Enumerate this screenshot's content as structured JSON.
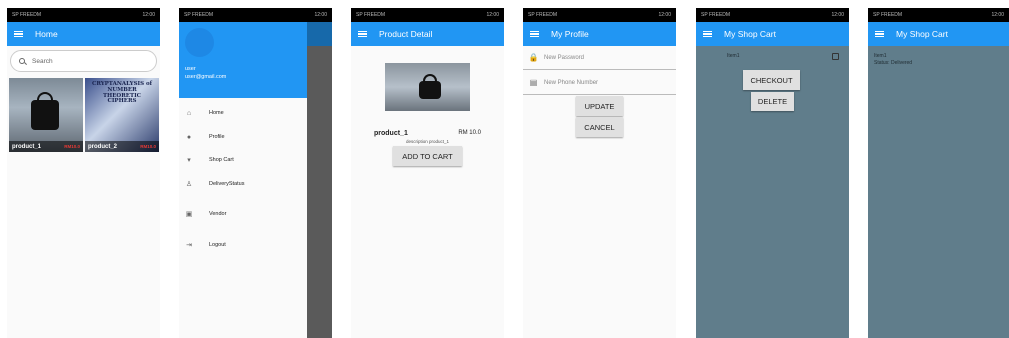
{
  "status_bar": {
    "left": "SP FREEDM",
    "right": "12:00"
  },
  "screens": {
    "home": {
      "title": "Home",
      "search_placeholder": "Search",
      "products": [
        {
          "name": "product_1",
          "price": "RM10.0",
          "image": "black-bag"
        },
        {
          "name": "product_2",
          "price": "RM10.0",
          "image": "book-cover"
        }
      ],
      "book_cover_text": "CRYPTANALYSIS of NUMBER THEORETIC CIPHERS"
    },
    "drawer": {
      "user": "user",
      "email": "user@gmail.com",
      "items": [
        {
          "label": "Home",
          "icon": "home-icon"
        },
        {
          "label": "Profile",
          "icon": "person-icon"
        },
        {
          "label": "Shop Cart",
          "icon": "cart-icon"
        },
        {
          "label": "DeliveryStatus",
          "icon": "delivery-icon"
        },
        {
          "label": "Vendor",
          "icon": "store-icon"
        },
        {
          "label": "Logout",
          "icon": "logout-icon"
        }
      ]
    },
    "detail": {
      "title": "Product Detail",
      "name": "product_1",
      "price": "RM 10.0",
      "description": "description product_1",
      "add_to_cart": "ADD TO CART"
    },
    "profile": {
      "title": "My Profile",
      "new_password_placeholder": "New Password",
      "new_phone_placeholder": "New Phone Number",
      "update": "UPDATE",
      "cancel": "CANCEL"
    },
    "cart": {
      "title": "My Shop Cart",
      "item": "Item1",
      "checkout": "CHECKOUT",
      "delete": "DELETE"
    },
    "delivery": {
      "title": "My Shop Cart",
      "item": "Item1",
      "status": "Status: Delivered"
    }
  },
  "colors": {
    "appbar": "#2196f3",
    "drawer_header": "#2196f3",
    "cart_bg": "#607d8b",
    "price": "#e53935"
  }
}
